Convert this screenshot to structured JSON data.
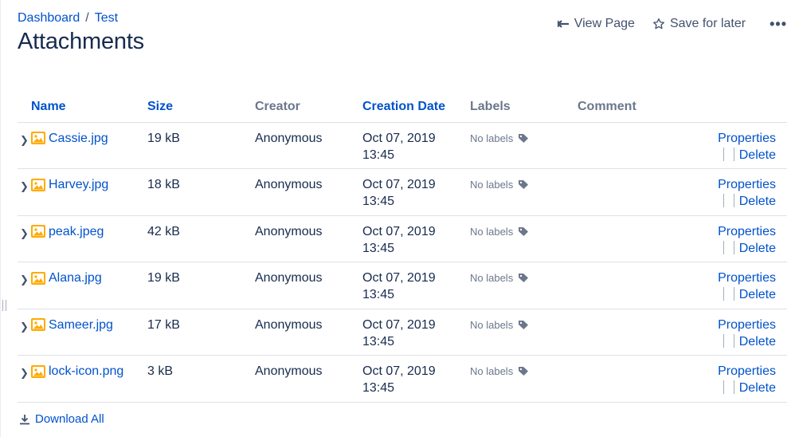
{
  "breadcrumb": {
    "items": [
      "Dashboard",
      "Test"
    ],
    "separator": "/"
  },
  "page": {
    "title": "Attachments"
  },
  "toolbar": {
    "view_page": "View Page",
    "save_for_later": "Save for later",
    "more": "•••"
  },
  "table": {
    "headers": {
      "name": "Name",
      "size": "Size",
      "creator": "Creator",
      "creation_date": "Creation Date",
      "labels": "Labels",
      "comment": "Comment"
    },
    "rows": [
      {
        "name": "Cassie.jpg",
        "size": "19 kB",
        "creator": "Anonymous",
        "date": "Oct 07, 2019",
        "time": "13:45",
        "labels": "No labels",
        "comment": "",
        "properties": "Properties",
        "delete": "Delete"
      },
      {
        "name": "Harvey.jpg",
        "size": "18 kB",
        "creator": "Anonymous",
        "date": "Oct 07, 2019",
        "time": "13:45",
        "labels": "No labels",
        "comment": "",
        "properties": "Properties",
        "delete": "Delete"
      },
      {
        "name": "peak.jpeg",
        "size": "42 kB",
        "creator": "Anonymous",
        "date": "Oct 07, 2019",
        "time": "13:45",
        "labels": "No labels",
        "comment": "",
        "properties": "Properties",
        "delete": "Delete"
      },
      {
        "name": "Alana.jpg",
        "size": "19 kB",
        "creator": "Anonymous",
        "date": "Oct 07, 2019",
        "time": "13:45",
        "labels": "No labels",
        "comment": "",
        "properties": "Properties",
        "delete": "Delete"
      },
      {
        "name": "Sameer.jpg",
        "size": "17 kB",
        "creator": "Anonymous",
        "date": "Oct 07, 2019",
        "time": "13:45",
        "labels": "No labels",
        "comment": "",
        "properties": "Properties",
        "delete": "Delete"
      },
      {
        "name": "lock-icon.png",
        "size": "3 kB",
        "creator": "Anonymous",
        "date": "Oct 07, 2019",
        "time": "13:45",
        "labels": "No labels",
        "comment": "",
        "properties": "Properties",
        "delete": "Delete"
      }
    ]
  },
  "footer": {
    "download_all": "Download All"
  },
  "icons": {
    "file": "image-file-icon",
    "expand": "chevron-right-icon",
    "labels": "tag-icon",
    "view_page": "arrow-left-icon",
    "save": "star-outline-icon",
    "download": "download-icon"
  },
  "colors": {
    "link": "#0052cc",
    "text": "#172b4d",
    "muted": "#6b778c",
    "image_icon": "#ffab00",
    "border": "#dfe1e6"
  }
}
